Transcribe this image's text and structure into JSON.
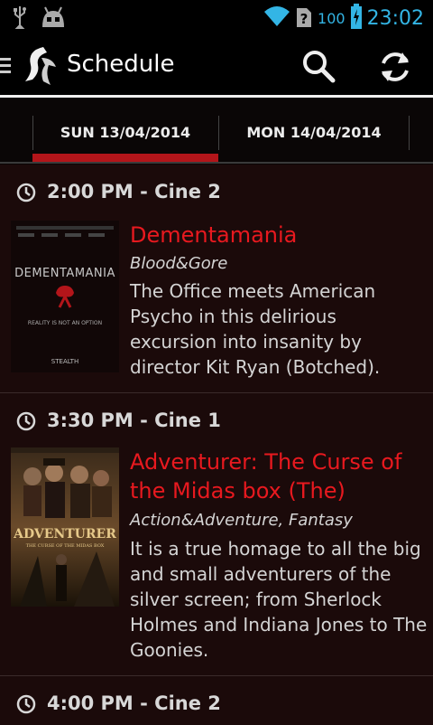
{
  "status_bar": {
    "battery_level": "100",
    "time": "23:02",
    "icons": [
      "usb-icon",
      "android-icon",
      "wifi-icon",
      "no-sim-icon",
      "battery-icon"
    ]
  },
  "action_bar": {
    "title": "Schedule",
    "icons": [
      "menu-icon",
      "app-logo",
      "search-icon",
      "refresh-icon"
    ]
  },
  "tabs": [
    {
      "label": "SUN 13/04/2014",
      "active": true
    },
    {
      "label": "MON 14/04/2014",
      "active": false
    }
  ],
  "colors": {
    "accent": "#b3151a",
    "title": "#e8191f",
    "status_blue": "#33b5e5"
  },
  "sessions": [
    {
      "time": "2:00 PM - Cine 2",
      "movies": [
        {
          "title": "Dementamania",
          "genre": "Blood&Gore",
          "description": "The Office meets American Psycho in this delirious excursion into insanity by director Kit Ryan (Botched).",
          "poster_text": "DEMENTAMANIA",
          "poster_tagline": "REALITY IS NOT AN OPTION",
          "poster_studio": "STEALTH"
        }
      ]
    },
    {
      "time": "3:30 PM - Cine 1",
      "movies": [
        {
          "title": "Adventurer: The Curse of the Midas box (The)",
          "genre": "Action&Adventure, Fantasy",
          "description": "It is a true homage to all the big and small adventurers of the silver screen; from Sherlock Holmes and Indiana Jones to The Goonies.",
          "poster_text": "ADVENTURER",
          "poster_tagline": "THE CURSE OF THE MIDAS BOX"
        }
      ]
    },
    {
      "time": "4:00 PM - Cine 2",
      "movies": []
    }
  ]
}
